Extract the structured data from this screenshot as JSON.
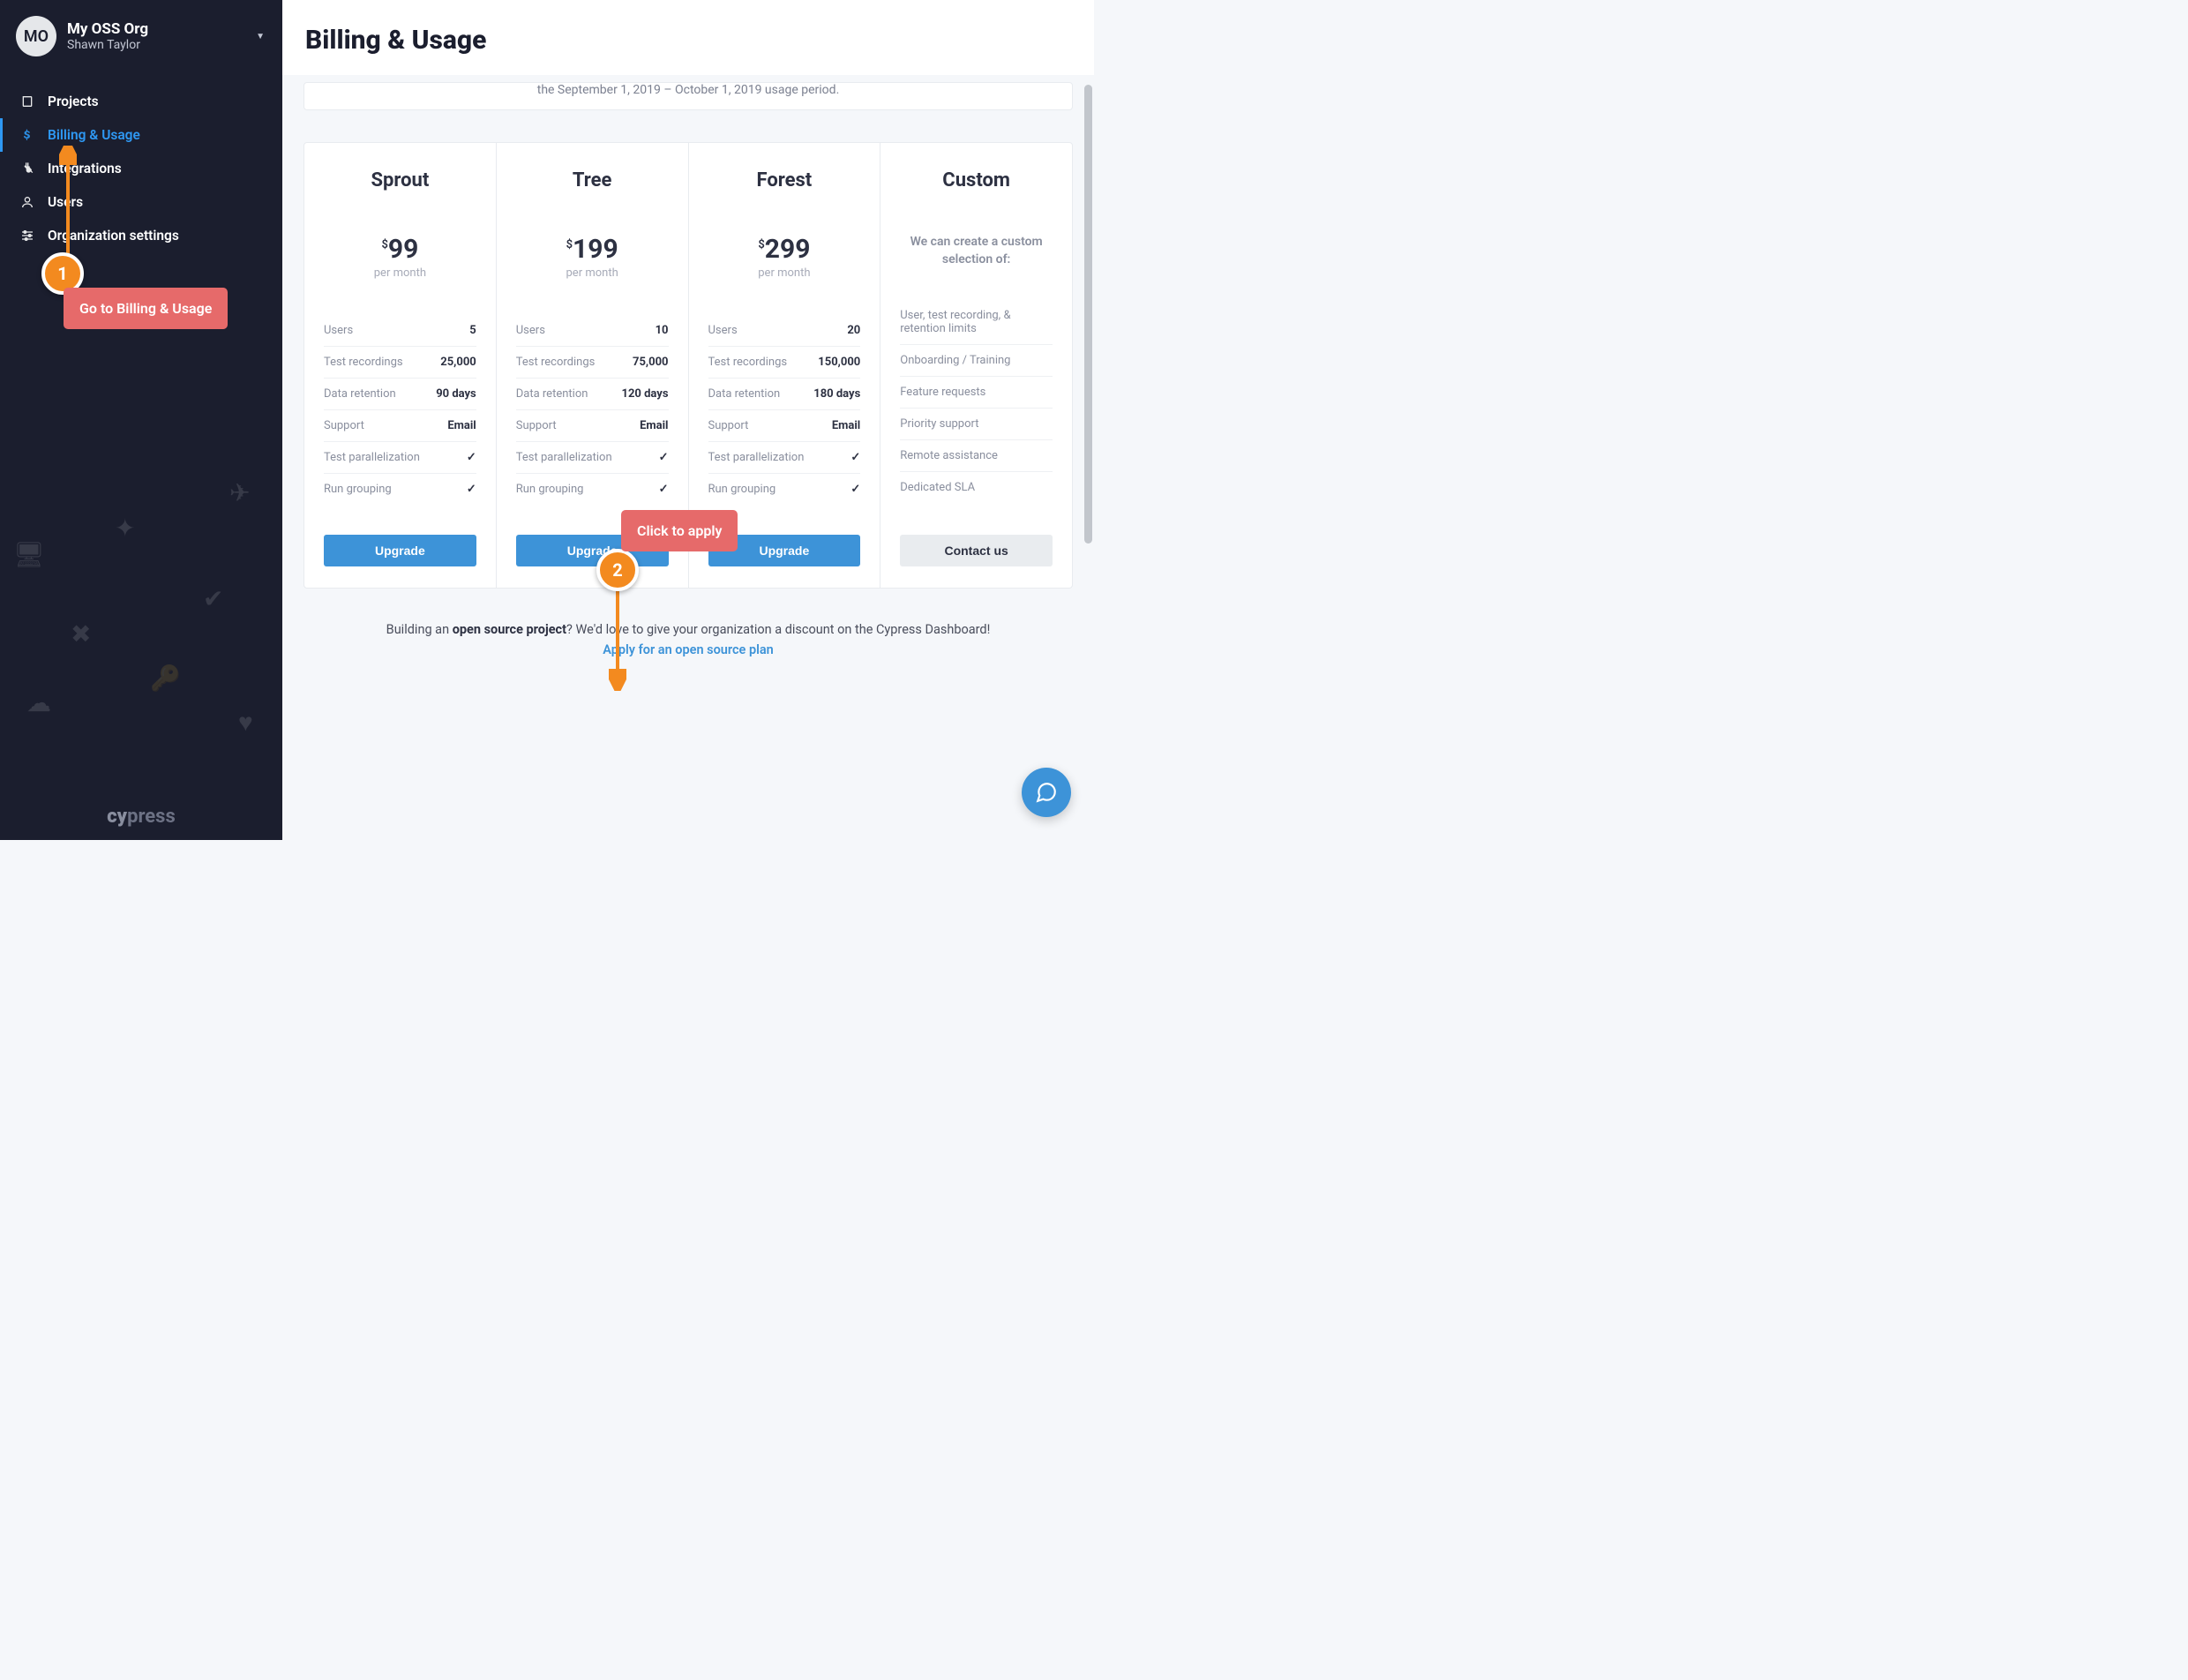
{
  "org": {
    "avatar_initials": "MO",
    "name": "My OSS Org",
    "user": "Shawn Taylor"
  },
  "sidebar": {
    "items": [
      {
        "label": "Projects",
        "icon": "book-icon"
      },
      {
        "label": "Billing & Usage",
        "icon": "dollar-icon",
        "active": true
      },
      {
        "label": "Integrations",
        "icon": "plug-icon"
      },
      {
        "label": "Users",
        "icon": "user-icon"
      },
      {
        "label": "Organization settings",
        "icon": "sliders-icon"
      }
    ],
    "brand": "cypress"
  },
  "header": {
    "title": "Billing & Usage"
  },
  "usage_period_text": "the September 1, 2019 – October 1, 2019 usage period.",
  "pricing": {
    "plans": [
      {
        "name": "Sprout",
        "currency": "$",
        "price": "99",
        "period": "per month",
        "features": [
          {
            "label": "Users",
            "value": "5"
          },
          {
            "label": "Test recordings",
            "value": "25,000"
          },
          {
            "label": "Data retention",
            "value": "90 days"
          },
          {
            "label": "Support",
            "value": "Email"
          },
          {
            "label": "Test parallelization",
            "value": "check"
          },
          {
            "label": "Run grouping",
            "value": "check"
          }
        ],
        "cta": "Upgrade"
      },
      {
        "name": "Tree",
        "currency": "$",
        "price": "199",
        "period": "per month",
        "features": [
          {
            "label": "Users",
            "value": "10"
          },
          {
            "label": "Test recordings",
            "value": "75,000"
          },
          {
            "label": "Data retention",
            "value": "120 days"
          },
          {
            "label": "Support",
            "value": "Email"
          },
          {
            "label": "Test parallelization",
            "value": "check"
          },
          {
            "label": "Run grouping",
            "value": "check"
          }
        ],
        "cta": "Upgrade"
      },
      {
        "name": "Forest",
        "currency": "$",
        "price": "299",
        "period": "per month",
        "features": [
          {
            "label": "Users",
            "value": "20"
          },
          {
            "label": "Test recordings",
            "value": "150,000"
          },
          {
            "label": "Data retention",
            "value": "180 days"
          },
          {
            "label": "Support",
            "value": "Email"
          },
          {
            "label": "Test parallelization",
            "value": "check"
          },
          {
            "label": "Run grouping",
            "value": "check"
          }
        ],
        "cta": "Upgrade"
      }
    ],
    "custom": {
      "name": "Custom",
      "lead": "We can create a custom selection of:",
      "items": [
        "User, test recording, & retention limits",
        "Onboarding / Training",
        "Feature requests",
        "Priority support",
        "Remote assistance",
        "Dedicated SLA"
      ],
      "cta": "Contact us"
    }
  },
  "oss": {
    "prefix": "Building an ",
    "bold": "open source project",
    "suffix": "? We'd love to give your organization a discount on the Cypress Dashboard!",
    "apply_label": "Apply for an open source plan"
  },
  "annotations": {
    "badge1": "1",
    "label1": "Go to Billing & Usage",
    "badge2": "2",
    "label2": "Click to apply"
  }
}
